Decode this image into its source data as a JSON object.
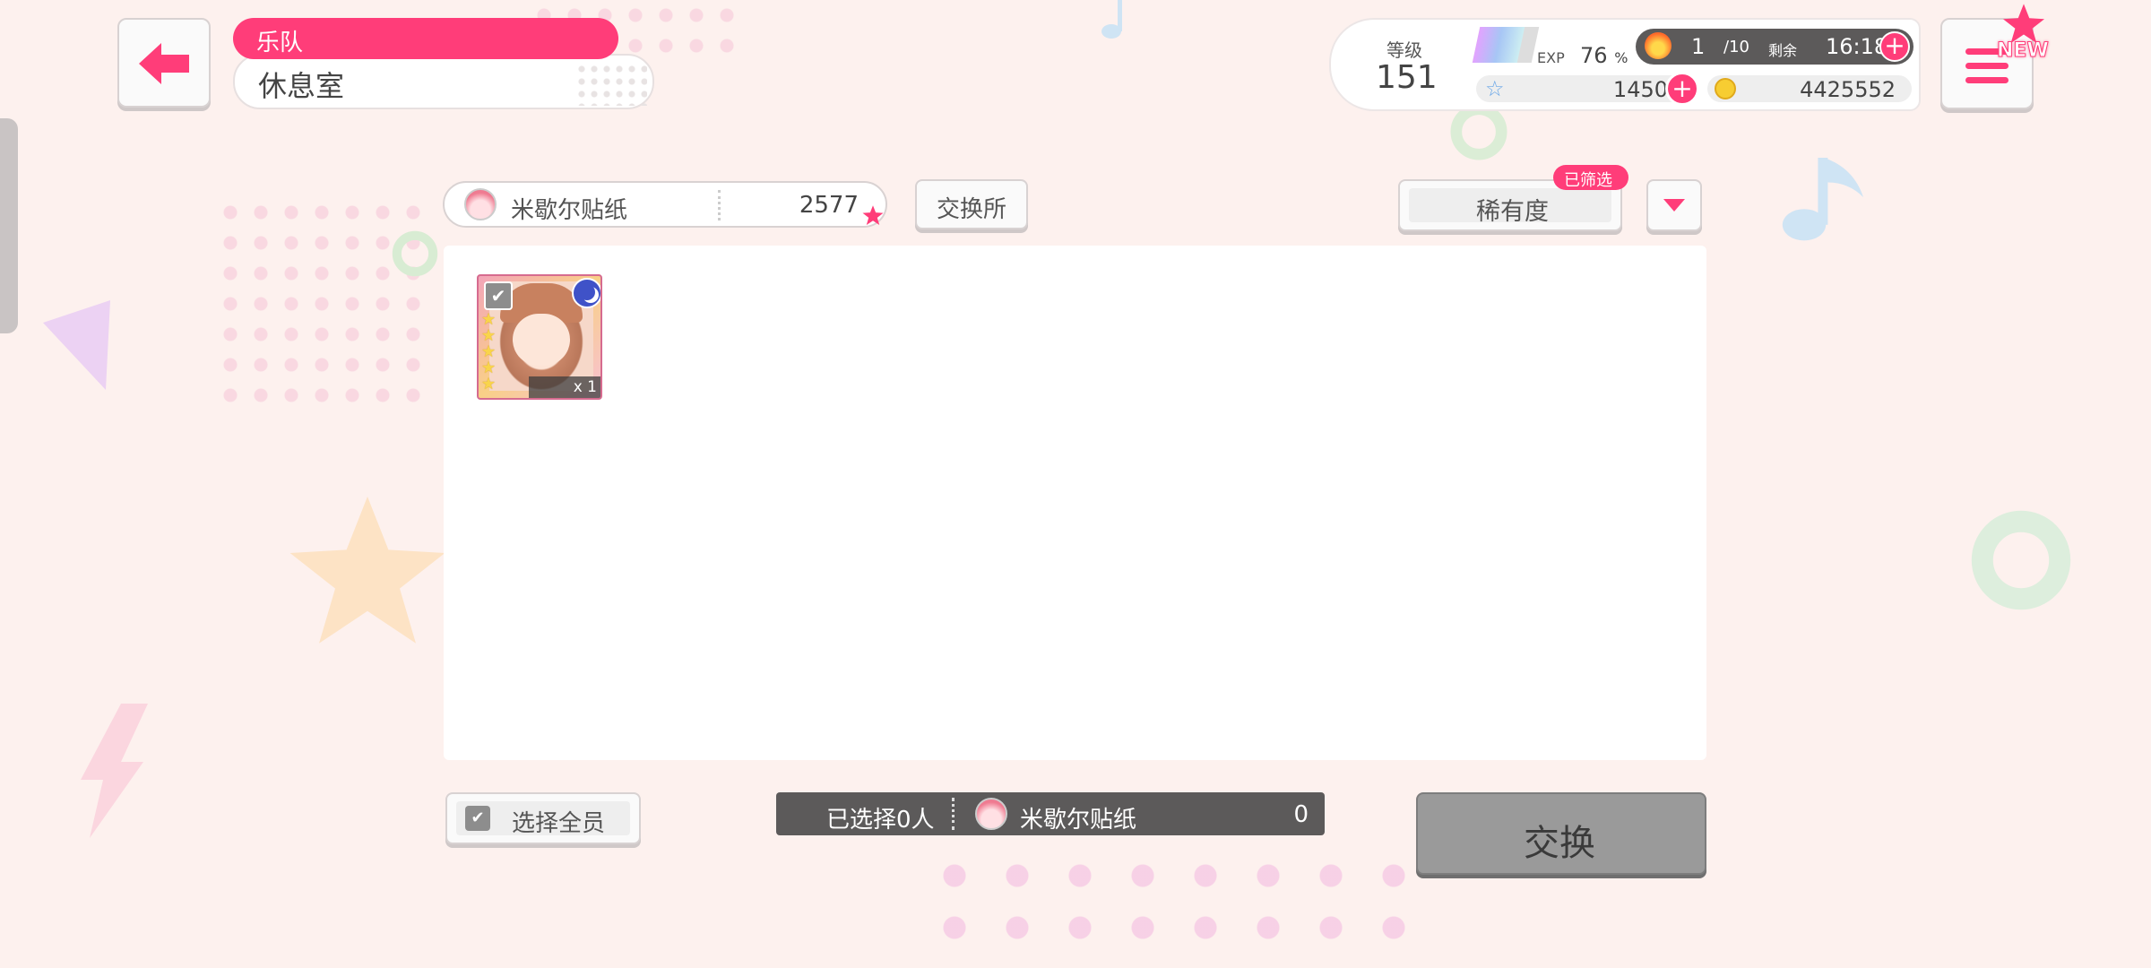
{
  "header": {
    "category": "乐队",
    "title": "休息室",
    "new_badge": "NEW"
  },
  "status": {
    "level_label": "等级",
    "level": "151",
    "exp_label": "EXP",
    "exp_percent": "76",
    "percent_sign": "%",
    "exp_fraction": 0.76,
    "stamina": "1",
    "stamina_max": "/10",
    "remaining_label": "剩余",
    "time": "16:18",
    "stars": "1450",
    "coins": "4425552"
  },
  "toolbar": {
    "item_name": "米歇尔贴纸",
    "item_count": "2577",
    "exchange_shop": "交换所",
    "sort_label": "稀有度",
    "filtered_badge": "已筛选"
  },
  "cards": [
    {
      "quantity": "x 1",
      "stars": 5,
      "attribute": "moon-icon"
    }
  ],
  "bottom": {
    "select_all": "选择全员",
    "selected": "已选择0人",
    "reward_name": "米歇尔贴纸",
    "reward_count": "0",
    "exchange": "交换"
  },
  "colors": {
    "accent": "#ff3d79",
    "background": "#fdf1ee",
    "panel": "#ffffff",
    "dark_bar": "#5c5a5a",
    "exchange_btn": "#9a9a9a"
  }
}
